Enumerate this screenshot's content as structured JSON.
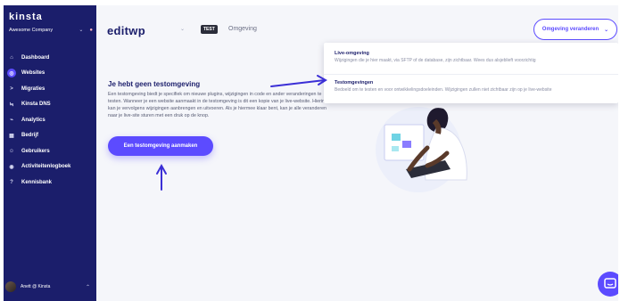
{
  "sidebar": {
    "logo": "KINSTa",
    "company": "Awesome Company",
    "items": [
      {
        "label": "Dashboard",
        "icon": "home-icon"
      },
      {
        "label": "Websites",
        "icon": "websites-icon"
      },
      {
        "label": "Migraties",
        "icon": "migrations-icon"
      },
      {
        "label": "Kinsta DNS",
        "icon": "dns-icon"
      },
      {
        "label": "Analytics",
        "icon": "analytics-icon"
      },
      {
        "label": "Bedrijf",
        "icon": "company-icon"
      },
      {
        "label": "Gebruikers",
        "icon": "users-icon"
      },
      {
        "label": "Activiteitenlogboek",
        "icon": "eye-icon"
      },
      {
        "label": "Kennisbank",
        "icon": "help-icon"
      }
    ],
    "user": "Anett @ Kinsta"
  },
  "header": {
    "site_title": "editwp",
    "env_badge": "TEST",
    "env_label": "Omgeving",
    "env_button": "Omgeving veranderen"
  },
  "dropdown": {
    "items": [
      {
        "title": "Live-omgeving",
        "desc": "Wijzigingen die je hier maakt, via SFTP of de database, zijn zichtbaar. Wees dus alsjeblieft voorzichtig"
      },
      {
        "title": "Testomgevingen",
        "desc": "Bedoeld om te testen en voor ontwikkelingsdoeleinden. Wijzigingen zullen niet zichtbaar zijn op je live-website"
      }
    ]
  },
  "main": {
    "heading": "Je hebt geen testomgeving",
    "body": "Een testomgeving biedt je specifiek om nieuwe plugins, wijzigingen in code en ander veranderingen te testen. Wanneer je een website aanmaakt in de testomgeving is dit een kopie van je live-website. Hierin kan je vervolgens wijzigingen aanbrengen en uitvoeren. Als je hiermee klaar bent, kan je alle veranderen naar je live-site sturen met een druk op de knop.",
    "button": "Een testomgeving aanmaken"
  },
  "colors": {
    "sidebar": "#1b1e6b",
    "accent": "#5c4bff",
    "annotation": "#3b2fd6"
  }
}
